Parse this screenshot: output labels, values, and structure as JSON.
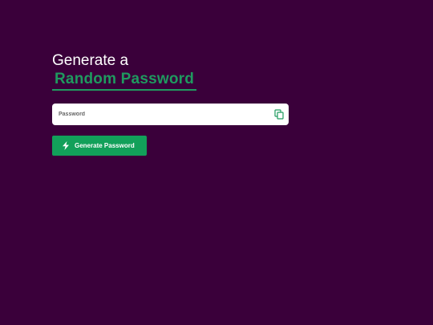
{
  "heading": {
    "line1": "Generate a",
    "line2": "Random Password"
  },
  "password_field": {
    "placeholder": "Password",
    "value": ""
  },
  "copy_button": {
    "icon": "copy-icon"
  },
  "generate_button": {
    "label": "Generate Password",
    "icon": "bolt-icon"
  },
  "colors": {
    "background": "#3a003a",
    "accent": "#1f9a5f",
    "button": "#12a05a"
  }
}
